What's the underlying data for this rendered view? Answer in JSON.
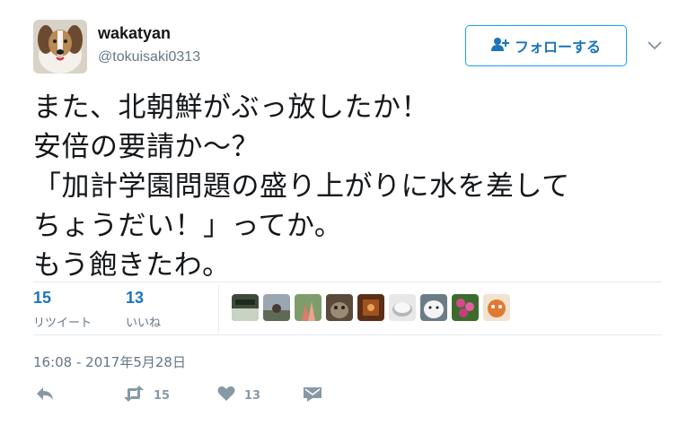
{
  "tweet": {
    "display_name": "wakatyan",
    "screen_name": "@tokuisaki0313",
    "follow_label": "フォローする",
    "text_lines": [
      "また、北朝鮮がぶっ放したか！",
      "安倍の要請か～？",
      "「加計学園問題の盛り上がりに水を差して",
      "ちょうだい！」ってか。",
      "もう飽きたわ。"
    ],
    "stats": {
      "retweets": {
        "count": "15",
        "label": "リツイート"
      },
      "likes": {
        "count": "13",
        "label": "いいね"
      }
    },
    "timestamp": "16:08 - 2017年5月28日",
    "actions": {
      "retweet_count": "15",
      "like_count": "13"
    }
  },
  "icons": {
    "follow": "user-plus-icon",
    "caret": "chevron-down-icon",
    "reply": "reply-icon",
    "retweet": "retweet-icon",
    "like": "heart-icon",
    "dm": "envelope-icon"
  },
  "colors": {
    "accent": "#1da1f2",
    "link": "#1b75bb",
    "muted": "#657786",
    "action_gray": "#8899a6"
  }
}
